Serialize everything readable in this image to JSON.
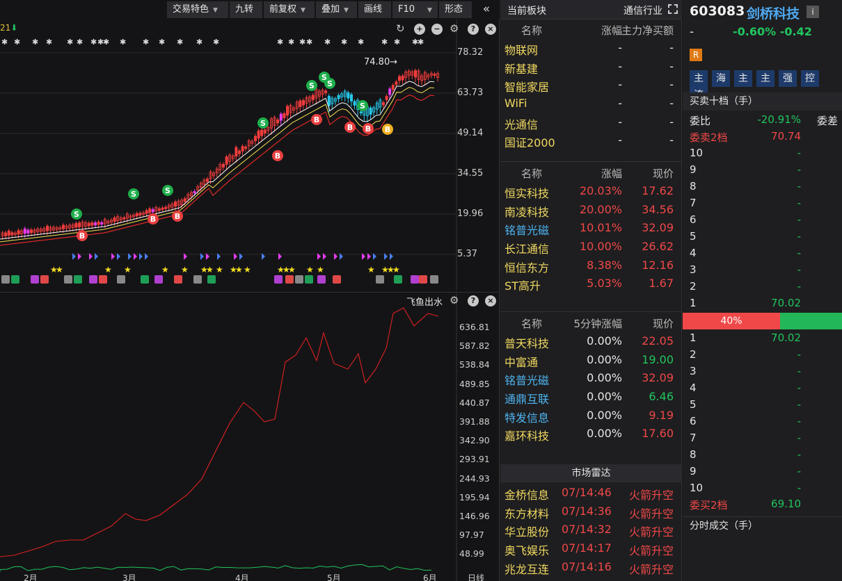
{
  "toolbar": {
    "buttons": [
      {
        "label": "交易特色",
        "dropdown": true
      },
      {
        "label": "九转",
        "dropdown": false
      },
      {
        "label": "前复权",
        "dropdown": true
      },
      {
        "label": "叠加",
        "dropdown": true
      },
      {
        "label": "画线",
        "dropdown": false
      },
      {
        "label": "F10",
        "dropdown": true
      },
      {
        "label": "形态",
        "dropdown": false
      }
    ]
  },
  "main_chart": {
    "period_flag": "21",
    "price_note": "74.80→",
    "y_labels": [
      "78.32",
      "63.73",
      "49.14",
      "34.55",
      "19.96",
      "5.37"
    ]
  },
  "sub_chart": {
    "title": "飞鱼出水",
    "y_labels": [
      "636.81",
      "587.82",
      "538.84",
      "489.85",
      "440.87",
      "391.88",
      "342.90",
      "293.91",
      "244.93",
      "195.94",
      "146.96",
      "97.97",
      "48.99"
    ],
    "x_labels": [
      "2月",
      "3月",
      "4月",
      "5月",
      "6月",
      "日线"
    ]
  },
  "sector": {
    "header_left": "当前板块",
    "header_right": "通信行业",
    "table1": {
      "headers": [
        "名称",
        "涨幅",
        "主力净买额"
      ],
      "rows": [
        {
          "name": "物联网",
          "chg": "-",
          "val": "-"
        },
        {
          "name": "新基建",
          "chg": "-",
          "val": "-"
        },
        {
          "name": "智能家居",
          "chg": "-",
          "val": "-"
        },
        {
          "name": "WiFi",
          "chg": "-",
          "val": "-"
        },
        {
          "name": "光通信",
          "chg": "-",
          "val": "-"
        },
        {
          "name": "国证2000",
          "chg": "-",
          "val": "-"
        }
      ]
    },
    "table2": {
      "headers": [
        "名称",
        "涨幅",
        "现价"
      ],
      "rows": [
        {
          "name": "恒实科技",
          "chg": "20.03%",
          "price": "17.62",
          "name_color": "y"
        },
        {
          "name": "南凌科技",
          "chg": "20.00%",
          "price": "34.56",
          "name_color": "y"
        },
        {
          "name": "铭普光磁",
          "chg": "10.01%",
          "price": "32.09",
          "name_color": "blu"
        },
        {
          "name": "长江通信",
          "chg": "10.00%",
          "price": "26.62",
          "name_color": "y"
        },
        {
          "name": "恒信东方",
          "chg": "8.38%",
          "price": "12.16",
          "name_color": "y"
        },
        {
          "name": "ST高升",
          "chg": "5.03%",
          "price": "1.67",
          "name_color": "y"
        }
      ]
    },
    "table3": {
      "headers": [
        "名称",
        "5分钟涨幅",
        "现价"
      ],
      "rows": [
        {
          "name": "普天科技",
          "chg": "0.00%",
          "price": "22.05",
          "name_color": "y",
          "price_color": "red"
        },
        {
          "name": "中富通",
          "chg": "0.00%",
          "price": "19.00",
          "name_color": "y",
          "price_color": "grn"
        },
        {
          "name": "铭普光磁",
          "chg": "0.00%",
          "price": "32.09",
          "name_color": "blu",
          "price_color": "red"
        },
        {
          "name": "通鼎互联",
          "chg": "0.00%",
          "price": "6.46",
          "name_color": "blu",
          "price_color": "grn"
        },
        {
          "name": "特发信息",
          "chg": "0.00%",
          "price": "9.19",
          "name_color": "blu",
          "price_color": "red"
        },
        {
          "name": "嘉环科技",
          "chg": "0.00%",
          "price": "17.60",
          "name_color": "y",
          "price_color": "red"
        }
      ]
    },
    "radar": {
      "title": "市场雷达",
      "rows": [
        {
          "name": "金桥信息",
          "time": "07/14:46",
          "event": "火箭升空"
        },
        {
          "name": "东方材料",
          "time": "07/14:36",
          "event": "火箭升空"
        },
        {
          "name": "华立股份",
          "time": "07/14:32",
          "event": "火箭升空"
        },
        {
          "name": "奥飞娱乐",
          "time": "07/14:17",
          "event": "火箭升空"
        },
        {
          "name": "兆龙互连",
          "time": "07/14:16",
          "event": "火箭升空"
        }
      ]
    }
  },
  "stock": {
    "code": "603083",
    "name": "剑桥科技",
    "info_icon": "i",
    "price": "-",
    "change_pct": "-0.60%",
    "change": "-0.42",
    "badge": "R",
    "tags": [
      "主",
      "海",
      "主",
      "主",
      "强",
      "控",
      "流"
    ],
    "orderbook_title": "买卖十档（手）",
    "ratio_label": "委比",
    "ratio_value": "-20.91%",
    "diff_label": "委差",
    "sell2_label": "委卖2档",
    "sell2_value": "70.74",
    "sell_levels": [
      {
        "lv": "10",
        "p": "-"
      },
      {
        "lv": "9",
        "p": "-"
      },
      {
        "lv": "8",
        "p": "-"
      },
      {
        "lv": "7",
        "p": "-"
      },
      {
        "lv": "6",
        "p": "-"
      },
      {
        "lv": "5",
        "p": "-"
      },
      {
        "lv": "4",
        "p": "-"
      },
      {
        "lv": "3",
        "p": "-"
      },
      {
        "lv": "2",
        "p": "-"
      },
      {
        "lv": "1",
        "p": "70.02"
      }
    ],
    "ratio_bar": "40%",
    "buy_levels": [
      {
        "lv": "1",
        "p": "70.02"
      },
      {
        "lv": "2",
        "p": "-"
      },
      {
        "lv": "3",
        "p": "-"
      },
      {
        "lv": "4",
        "p": "-"
      },
      {
        "lv": "5",
        "p": "-"
      },
      {
        "lv": "6",
        "p": "-"
      },
      {
        "lv": "7",
        "p": "-"
      },
      {
        "lv": "8",
        "p": "-"
      },
      {
        "lv": "9",
        "p": "-"
      },
      {
        "lv": "10",
        "p": "-"
      }
    ],
    "buy2_label": "委买2档",
    "buy2_value": "69.10",
    "trades_title": "分时成交（手）"
  }
}
